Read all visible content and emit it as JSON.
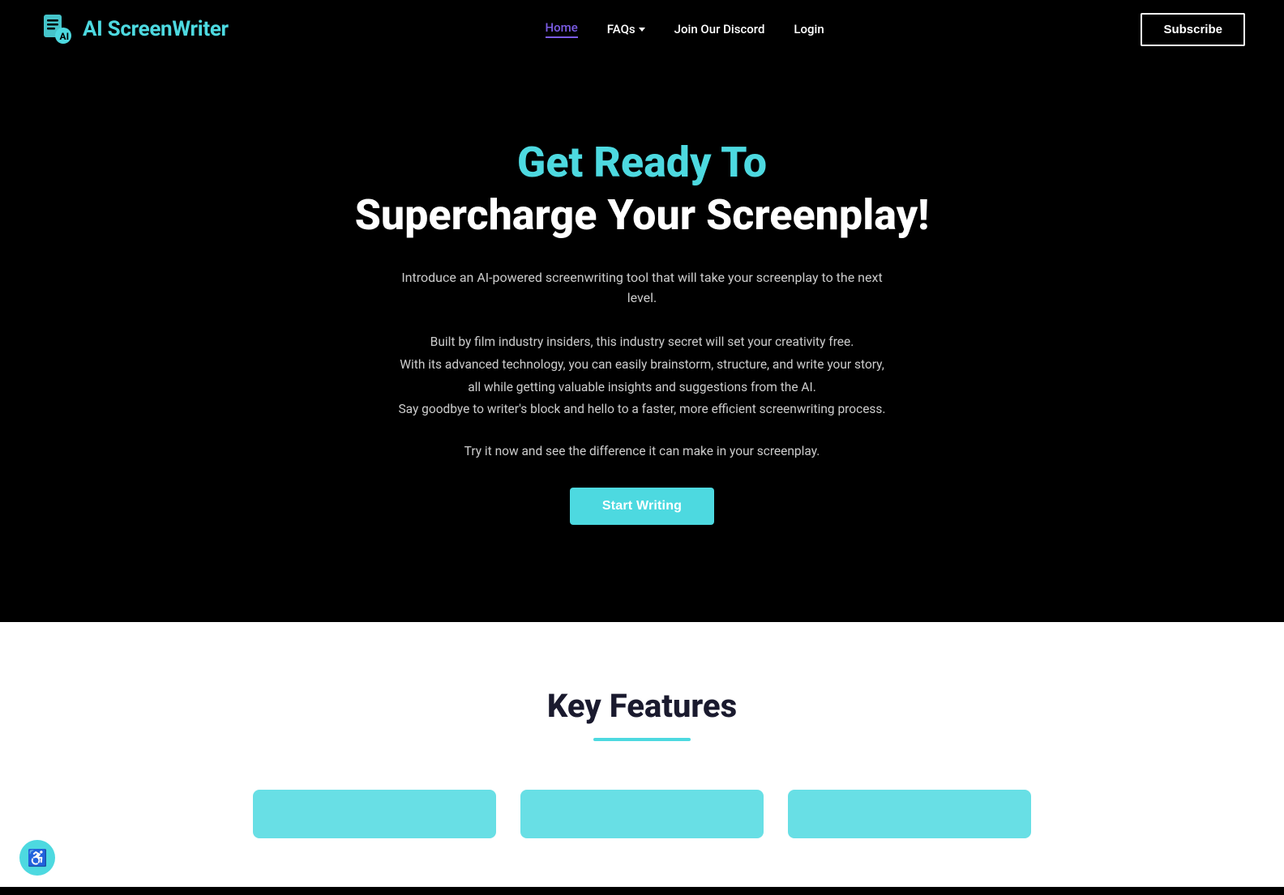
{
  "colors": {
    "accent": "#4dd9e0",
    "bg_dark": "#000000",
    "bg_light": "#ffffff",
    "nav_active": "#7b5ce5",
    "text_primary": "#ffffff",
    "text_muted": "#cccccc",
    "text_dark": "#1a1a2e"
  },
  "nav": {
    "logo_text_plain": "AI ScreenWriter",
    "logo_text_accent": "AI ",
    "logo_text_rest": "ScreenWriter",
    "links": [
      {
        "label": "Home",
        "active": true
      },
      {
        "label": "FAQs",
        "has_dropdown": true
      },
      {
        "label": "Join Our Discord",
        "active": false
      },
      {
        "label": "Login",
        "active": false
      }
    ],
    "subscribe_label": "Subscribe"
  },
  "hero": {
    "title_top": "Get Ready To",
    "title_bottom": "Supercharge Your Screenplay!",
    "intro": "Introduce an AI-powered screenwriting tool that will take your screenplay to the next level.",
    "body_line1": "Built by film industry insiders, this industry secret will set your creativity free.",
    "body_line2": "With its advanced technology, you can easily brainstorm, structure, and write your story,",
    "body_line3": "all while getting valuable insights and suggestions from the AI.",
    "body_line4": "Say goodbye to writer's block and hello to a faster, more efficient screenwriting process.",
    "cta_text": "Try it now and see the difference it can make in your screenplay.",
    "start_writing_label": "Start Writing"
  },
  "key_features": {
    "title": "Key Features",
    "cards": [
      {
        "id": 1
      },
      {
        "id": 2
      },
      {
        "id": 3
      }
    ]
  },
  "accessibility": {
    "icon": "♿"
  }
}
